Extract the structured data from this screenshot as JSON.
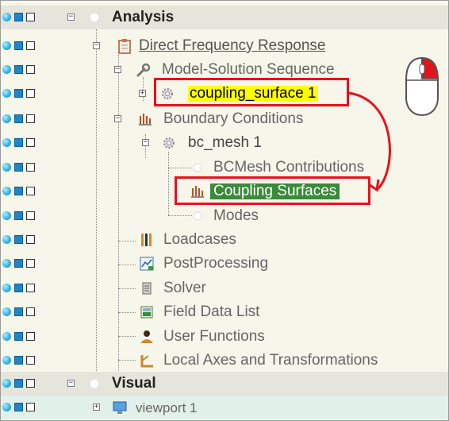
{
  "tree": {
    "analysis_label": "Analysis",
    "direct_frequency_response": "Direct Frequency Response",
    "model_solution_sequence": "Model-Solution Sequence",
    "coupling_surface": "coupling_surface 1",
    "boundary_conditions": "Boundary Conditions",
    "bc_mesh": "bc_mesh 1",
    "bcmesh_contributions": "BCMesh Contributions",
    "coupling_surfaces": "Coupling Surfaces",
    "modes": "Modes",
    "loadcases": "Loadcases",
    "postprocessing": "PostProcessing",
    "solver": "Solver",
    "field_data_list": "Field Data List",
    "user_functions": "User Functions",
    "local_axes": "Local Axes and Transformations",
    "visual_label": "Visual",
    "viewport": "viewport 1"
  },
  "colors": {
    "highlight_box": "#e8111b",
    "selected_bg": "#3a8a3a",
    "yellow_highlight": "#ffff00",
    "visibility_blue": "#31b3ea"
  },
  "annotation": {
    "mouse_icon": "mouse-right-click-icon",
    "arrow_icon": "curved-arrow-icon"
  }
}
